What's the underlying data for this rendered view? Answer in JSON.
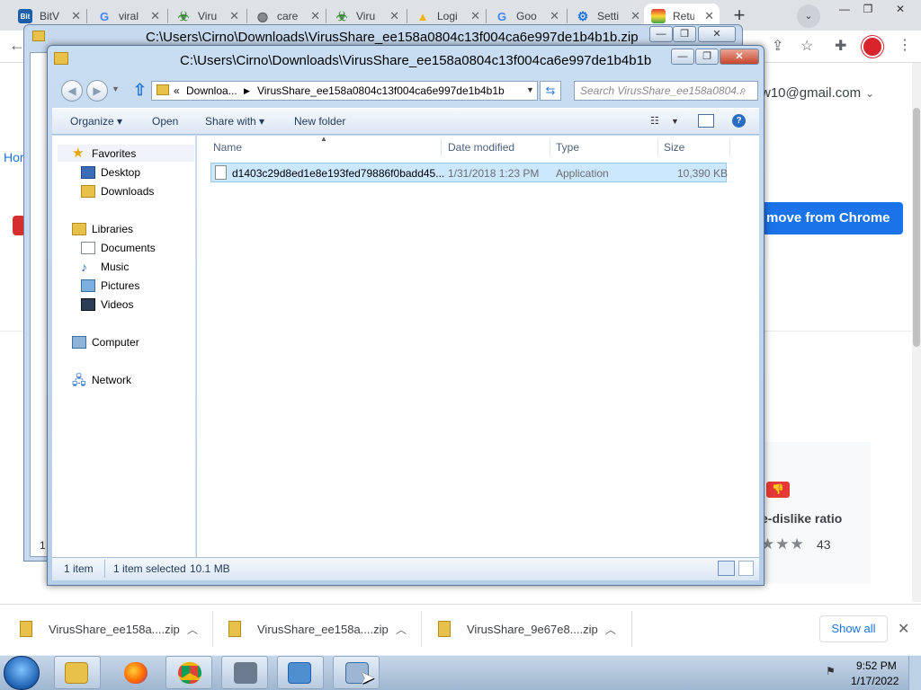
{
  "browser": {
    "tabs": [
      {
        "label": "BitV",
        "icon": "bitvirus-icon",
        "active": false
      },
      {
        "label": "viral",
        "icon": "google-icon",
        "active": false
      },
      {
        "label": "Viru",
        "icon": "biohazard-icon",
        "active": false
      },
      {
        "label": "care",
        "icon": "globe-icon",
        "active": false
      },
      {
        "label": "Viru",
        "icon": "biohazard-icon",
        "active": false
      },
      {
        "label": "Logi",
        "icon": "drive-icon",
        "active": false
      },
      {
        "label": "Goo",
        "icon": "google-icon",
        "active": false
      },
      {
        "label": "Setti",
        "icon": "gear-icon",
        "active": false
      },
      {
        "label": "Retu",
        "icon": "rainbow-icon",
        "active": true
      }
    ],
    "account_email": "w10@gmail.com",
    "home_link": "Hor",
    "remove_button": "move from Chrome",
    "rating_label": "e-dislike ratio",
    "rating_stars": "★★★",
    "rating_count": "43",
    "downloads": [
      {
        "label": "VirusShare_ee158a....zip"
      },
      {
        "label": "VirusShare_ee158a....zip"
      },
      {
        "label": "VirusShare_9e67e8....zip"
      }
    ],
    "show_all": "Show all"
  },
  "window_back": {
    "title": "C:\\Users\\Cirno\\Downloads\\VirusShare_ee158a0804c13f004ca6e997de1b4b1b.zip",
    "footer": "1"
  },
  "window_front": {
    "title": "C:\\Users\\Cirno\\Downloads\\VirusShare_ee158a0804c13f004ca6e997de1b4b1b",
    "address": {
      "prefix": "«",
      "crumb1": "Downloa...",
      "crumb2": "VirusShare_ee158a0804c13f004ca6e997de1b4b1b"
    },
    "search_placeholder": "Search VirusShare_ee158a0804...",
    "commands": {
      "organize": "Organize ▾",
      "open": "Open",
      "share_with": "Share with ▾",
      "new_folder": "New folder"
    },
    "nav": {
      "favorites": "Favorites",
      "desktop": "Desktop",
      "downloads": "Downloads",
      "libraries": "Libraries",
      "documents": "Documents",
      "music": "Music",
      "pictures": "Pictures",
      "videos": "Videos",
      "computer": "Computer",
      "network": "Network"
    },
    "columns": {
      "name": "Name",
      "date_modified": "Date modified",
      "type": "Type",
      "size": "Size"
    },
    "files": [
      {
        "name": "d1403c29d8ed1e8e193fed79886f0badd45...",
        "date_modified": "1/31/2018 1:23 PM",
        "type": "Application",
        "size": "10,390 KB",
        "selected": true
      }
    ],
    "status": {
      "count": "1 item",
      "selected": "1 item selected",
      "size": "10.1 MB"
    }
  },
  "taskbar": {
    "apps": [
      "explorer-icon",
      "firefox-icon",
      "chrome-icon",
      "media-icon",
      "network-icon",
      "app-icon"
    ],
    "time": "9:52 PM",
    "date": "1/17/2022"
  }
}
